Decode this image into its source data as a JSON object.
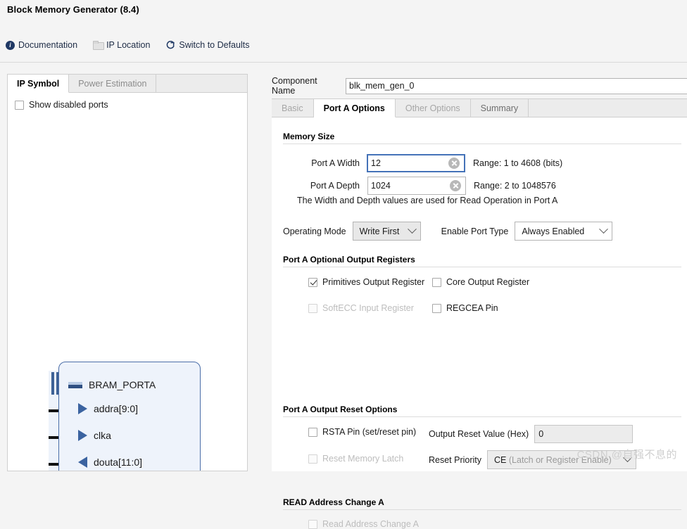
{
  "dialog": {
    "title": "Block Memory Generator (8.4)"
  },
  "toolbar": {
    "documentation": "Documentation",
    "ip_location": "IP Location",
    "switch_defaults": "Switch to Defaults",
    "icons": {
      "documentation": "info-icon",
      "ip_location": "folder-icon",
      "switch_defaults": "refresh-icon"
    }
  },
  "left_panel": {
    "tabs": [
      {
        "label": "IP Symbol",
        "active": true
      },
      {
        "label": "Power Estimation",
        "active": false
      }
    ],
    "show_disabled_ports": {
      "label": "Show disabled ports",
      "checked": false
    },
    "symbol": {
      "block_label": "BRAM_PORTA",
      "ports": [
        {
          "name": "addra[9:0]",
          "direction": "in"
        },
        {
          "name": "clka",
          "direction": "in"
        },
        {
          "name": "douta[11:0]",
          "direction": "out"
        }
      ]
    }
  },
  "component_name": {
    "label": "Component Name",
    "value": "blk_mem_gen_0",
    "placeholder": ""
  },
  "right_tabs": [
    {
      "label": "Basic",
      "active": false,
      "style": "dim"
    },
    {
      "label": "Port A Options",
      "active": true,
      "style": "active"
    },
    {
      "label": "Other Options",
      "active": false,
      "style": "dim"
    },
    {
      "label": "Summary",
      "active": false,
      "style": "dim2"
    }
  ],
  "memory_size": {
    "title": "Memory Size",
    "width": {
      "label": "Port A Width",
      "value": "12",
      "range": "Range: 1 to 4608 (bits)",
      "focused": true
    },
    "depth": {
      "label": "Port A Depth",
      "value": "1024",
      "range": "Range: 2 to 1048576",
      "focused": false
    },
    "hint": "The Width and Depth values are used for Read Operation in Port A",
    "operating_mode": {
      "label": "Operating Mode",
      "value": "Write First"
    },
    "enable_port_type": {
      "label": "Enable Port Type",
      "value": "Always Enabled"
    }
  },
  "optional_output_registers": {
    "title": "Port A Optional Output Registers",
    "items": [
      {
        "label": "Primitives Output Register",
        "checked": true,
        "disabled": false
      },
      {
        "label": "Core Output Register",
        "checked": false,
        "disabled": false
      },
      {
        "label": "SoftECC Input Register",
        "checked": false,
        "disabled": true
      },
      {
        "label": "REGCEA Pin",
        "checked": false,
        "disabled": false
      }
    ]
  },
  "output_reset_options": {
    "title": "Port A Output Reset Options",
    "rsta_pin": {
      "label": "RSTA Pin (set/reset pin)",
      "checked": false,
      "disabled": false
    },
    "reset_memory_latch": {
      "label": "Reset Memory Latch",
      "checked": false,
      "disabled": true
    },
    "output_reset_value": {
      "label": "Output Reset Value (Hex)",
      "value": "0"
    },
    "reset_priority": {
      "label": "Reset Priority",
      "value_primary": "CE",
      "value_secondary": "(Latch or Register Enable)"
    }
  },
  "read_address_change": {
    "title": "READ Address Change A",
    "checkbox": {
      "label": "Read Address Change A",
      "checked": false,
      "disabled": true
    }
  },
  "watermark": "CSDN @自强不息的",
  "colors": {
    "accent": "#1f3864",
    "focus_border": "#4472b8",
    "symbol_border": "#4b6ea8",
    "symbol_fill": "#eef3fb",
    "pin_arrow": "#3b63a0"
  }
}
